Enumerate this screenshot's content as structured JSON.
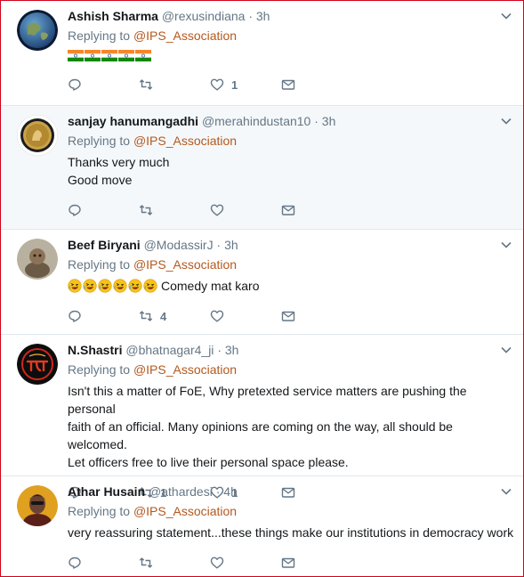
{
  "reply_prefix": "Replying to",
  "tweets": [
    {
      "name": "Ashish Sharma",
      "handle": "@rexusindiana",
      "time": "3h",
      "reply_to": "@IPS_Association",
      "avatar": "earth-globe",
      "body_emoji": [
        "flag-india",
        "flag-india",
        "flag-india",
        "flag-india",
        "flag-india"
      ],
      "lines": [],
      "replies": "",
      "retweets": "",
      "likes": "1",
      "highlight": false
    },
    {
      "name": "sanjay hanumangadhi",
      "handle": "@merahindustan10",
      "time": "3h",
      "reply_to": "@IPS_Association",
      "avatar": "gold-medal",
      "lines": [
        "Thanks very much",
        "Good move"
      ],
      "replies": "",
      "retweets": "",
      "likes": "",
      "highlight": true
    },
    {
      "name": "Beef Biryani",
      "handle": "@ModassirJ",
      "time": "3h",
      "reply_to": "@IPS_Association",
      "avatar": "figurine",
      "body_emoji": [
        "rofl",
        "rofl",
        "rofl",
        "rofl",
        "rofl",
        "rofl"
      ],
      "lines": [
        "Comedy mat karo"
      ],
      "replies": "",
      "retweets": "4",
      "likes": "",
      "highlight": false
    },
    {
      "name": "N.Shastri",
      "handle": "@bhatnagar4_ji",
      "time": "3h",
      "reply_to": "@IPS_Association",
      "avatar": "logo-red-black",
      "lines": [
        "Isn't this a matter of FoE, Why pretexted service matters are pushing the personal",
        "faith of an official. Many opinions are coming on the way, all should be welcomed.",
        "Let officers free to live their personal space please."
      ],
      "replies": "",
      "retweets": "1",
      "likes": "1",
      "highlight": false
    },
    {
      "name": "Athar Husain",
      "handle": "@athardesi",
      "time": "4h",
      "reply_to": "@IPS_Association",
      "avatar": "portrait",
      "lines": [
        "very reassuring statement...these things make our institutions in democracy work"
      ],
      "replies": "",
      "retweets": "",
      "likes": "",
      "highlight": false
    }
  ],
  "colors": {
    "link": "#b3591f",
    "muted": "#657786",
    "text": "#14171a",
    "divider": "#e1e8ed",
    "highlight_bg": "#f5f8fa",
    "frame_border": "#d0021b"
  }
}
